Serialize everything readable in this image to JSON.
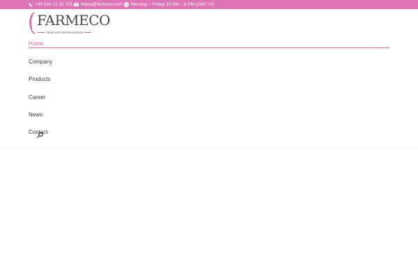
{
  "topbar": {
    "phone": "+30 210 21 31 701",
    "email": "Inbox@farmeco.com",
    "hours": "Monday – Friday 10 AM – 8 PM (GMT+2)",
    "background": "#dc74b5"
  },
  "logo": {
    "brand": "FARMECO",
    "tagline": "Advanced Dermoceuticals"
  },
  "nav": {
    "items": [
      {
        "label": "Home",
        "active": true
      },
      {
        "label": "Company"
      },
      {
        "label": "Products"
      },
      {
        "label": "Career"
      },
      {
        "label": "News"
      },
      {
        "label": "Contact"
      }
    ],
    "accent": "#d36aa9"
  },
  "icons": [
    "phone-icon",
    "email-icon",
    "clock-icon",
    "search-icon"
  ]
}
